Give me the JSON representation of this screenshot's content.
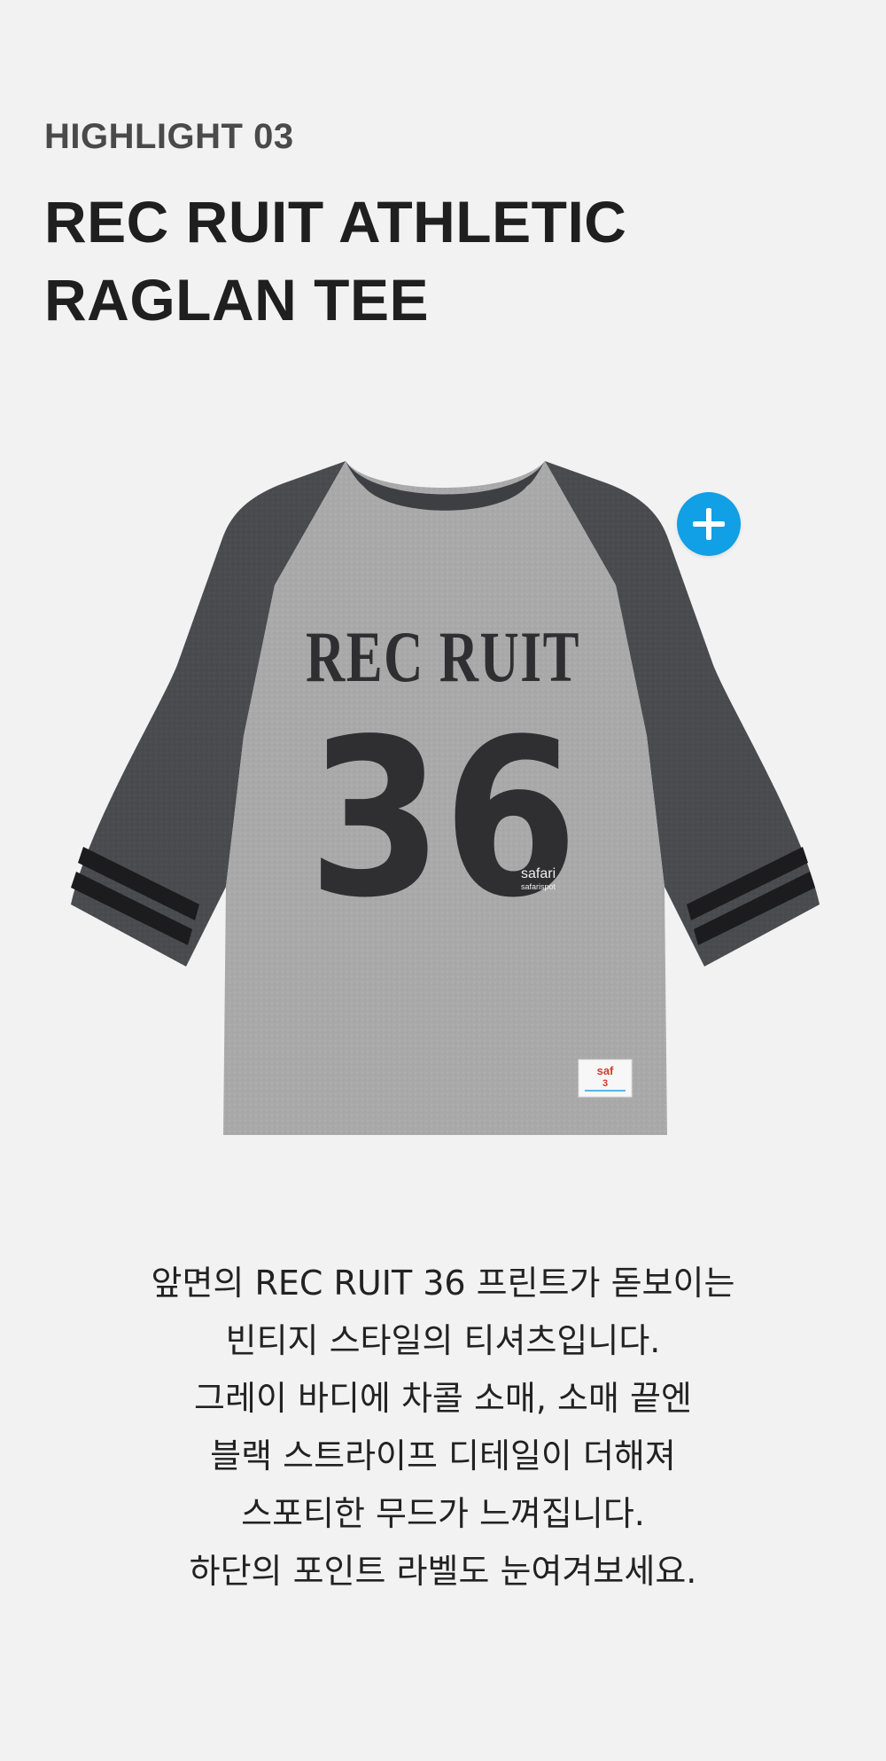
{
  "highlight": {
    "eyebrow": "HIGHLIGHT 03",
    "title_line1": "REC RUIT ATHLETIC",
    "title_line2": "RAGLAN TEE"
  },
  "product": {
    "image_alt": "Gray raglan tee with charcoal 3/4 sleeves and black stripes",
    "print_text": "REC RUIT",
    "print_number": "36",
    "brand_print": "safari",
    "brand_print_sub": "safarispot",
    "label_text": "saf",
    "label_number": "3",
    "body_color": "#a9a9a9",
    "sleeve_color": "#4a4b4f",
    "print_color": "#2f2f31",
    "stripe_color": "#1c1c1e"
  },
  "detail_button": {
    "icon": "plus-icon",
    "color": "#119fe6"
  },
  "description": {
    "lines": [
      "앞면의 REC RUIT 36 프린트가 돋보이는",
      "빈티지 스타일의 티셔츠입니다.",
      "그레이 바디에 차콜 소매, 소매 끝엔",
      "블랙 스트라이프 디테일이 더해져",
      "스포티한 무드가 느껴집니다.",
      "하단의 포인트 라벨도 눈여겨보세요."
    ]
  }
}
